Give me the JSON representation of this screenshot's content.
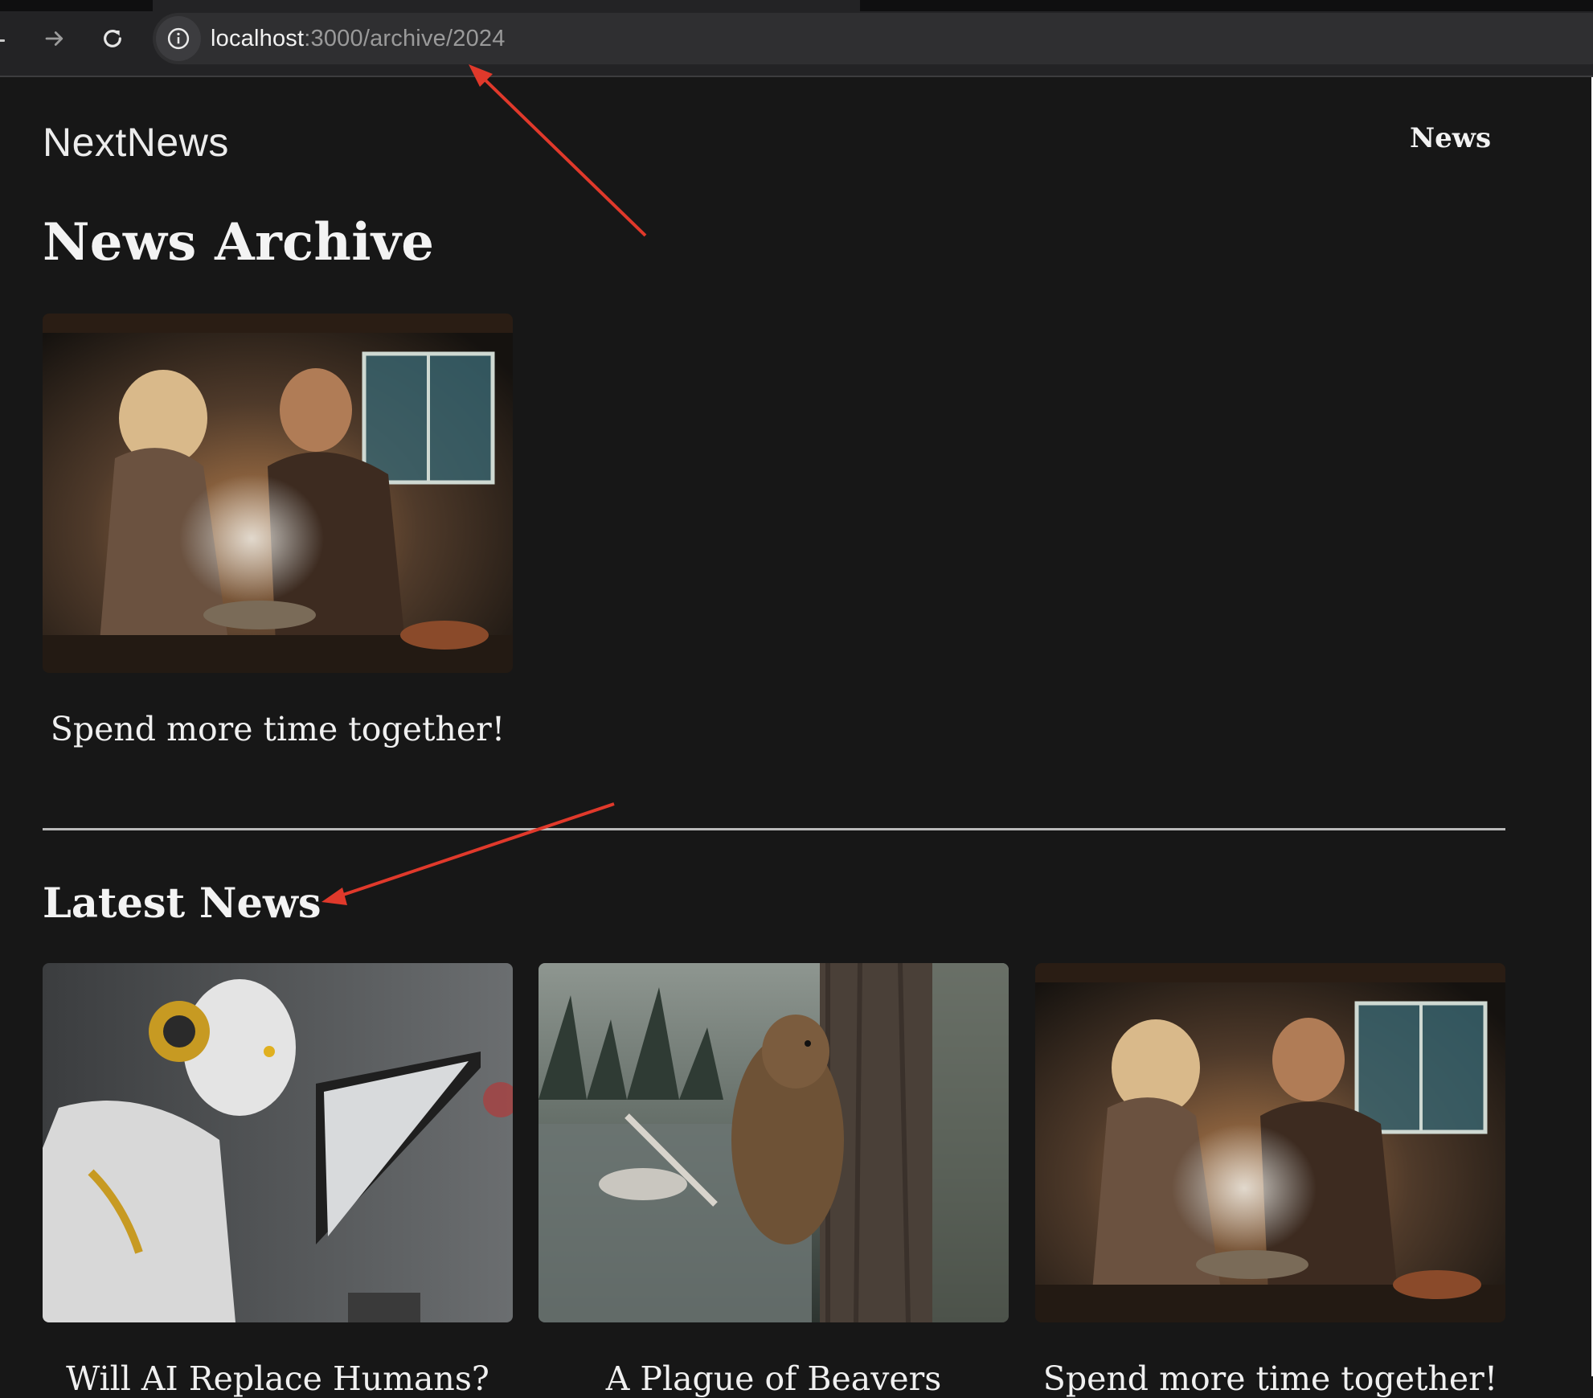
{
  "browser": {
    "url_host": "localhost",
    "url_path": ":3000/archive/2024",
    "icons": [
      "back-arrow-icon",
      "forward-arrow-icon",
      "reload-icon",
      "info-icon"
    ]
  },
  "header": {
    "logo": "NextNews",
    "nav_news": "News"
  },
  "archive": {
    "title": "News Archive",
    "items": [
      {
        "title": "Spend more time together!",
        "image": "cooking-couple-kitchen"
      }
    ]
  },
  "latest": {
    "title": "Latest News",
    "items": [
      {
        "title": "Will AI Replace Humans?",
        "image": "robot-with-tablet"
      },
      {
        "title": "A Plague of Beavers",
        "image": "beaver-climbing-tree"
      },
      {
        "title": "Spend more time together!",
        "image": "cooking-couple-kitchen"
      }
    ]
  },
  "annotations": {
    "arrow_color": "#e0392b"
  }
}
